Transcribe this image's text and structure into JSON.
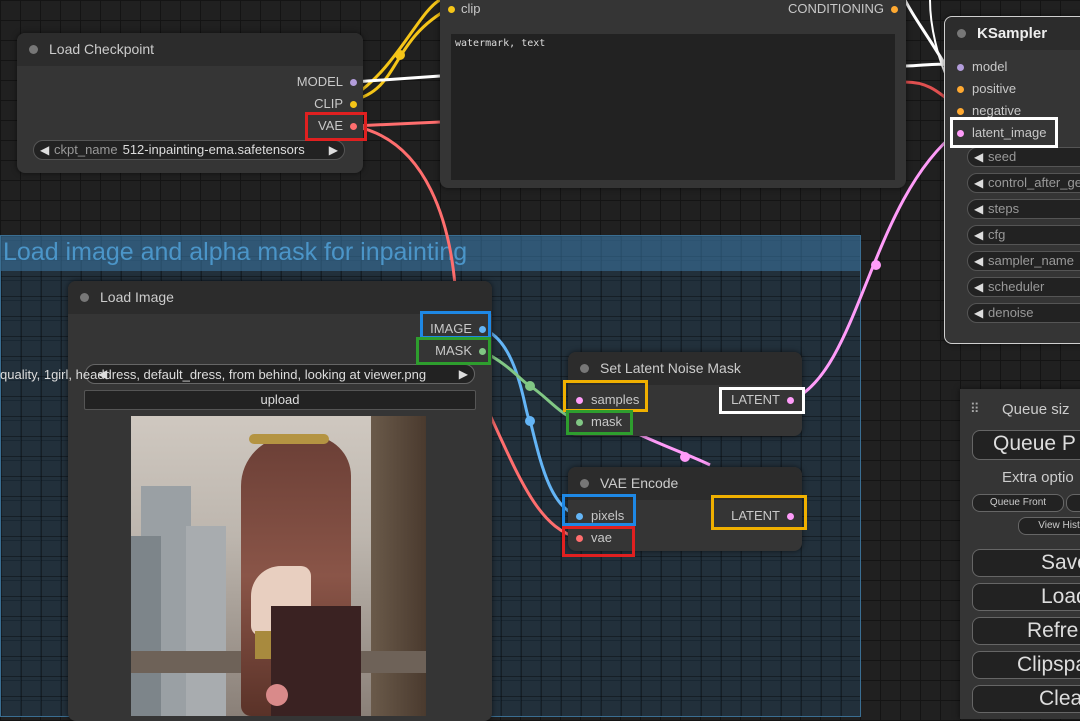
{
  "group": {
    "title": "Load image and alpha mask for inpainting"
  },
  "text_node": {
    "input_clip": "clip",
    "output_conditioning": "CONDITIONING",
    "text": "watermark, text"
  },
  "load_checkpoint": {
    "title": "Load Checkpoint",
    "outputs": [
      "MODEL",
      "CLIP",
      "VAE"
    ],
    "ckpt_label": "ckpt_name",
    "ckpt_value": "512-inpainting-ema.safetensors"
  },
  "ksampler": {
    "title": "KSampler",
    "inputs": [
      "model",
      "positive",
      "negative",
      "latent_image"
    ],
    "widgets": [
      "seed",
      "control_after_ge",
      "steps",
      "cfg",
      "sampler_name",
      "scheduler",
      "denoise"
    ]
  },
  "load_image": {
    "title": "Load Image",
    "outputs": [
      "IMAGE",
      "MASK"
    ],
    "image_value": "quality, 1girl,  headdress, default_dress, from behind, looking at viewer.png",
    "upload_label": "upload"
  },
  "set_latent_noise_mask": {
    "title": "Set Latent Noise Mask",
    "inputs": [
      "samples",
      "mask"
    ],
    "output": "LATENT"
  },
  "vae_encode": {
    "title": "VAE Encode",
    "inputs": [
      "pixels",
      "vae"
    ],
    "output": "LATENT"
  },
  "queue_panel": {
    "queue_size": "Queue siz",
    "queue_prompt": "Queue P",
    "extra_options": "Extra optio",
    "queue_front": "Queue Front",
    "view_history": "View Hist",
    "save": "Save",
    "load": "Load",
    "refresh": "Refre",
    "clipspace": "Clipspa",
    "clear": "Clea"
  },
  "colors": {
    "clip": "#f5c518",
    "model": "#b39ddb",
    "vae": "#ff6e6e",
    "conditioning": "#ffa931",
    "latent": "#ff9cf9",
    "image": "#64b5f6",
    "mask": "#81c784",
    "highlight_red": "#e02020",
    "highlight_blue": "#1e88e5",
    "highlight_green": "#2e9e2e",
    "highlight_yellow": "#f0b000",
    "highlight_white": "#ffffff"
  }
}
